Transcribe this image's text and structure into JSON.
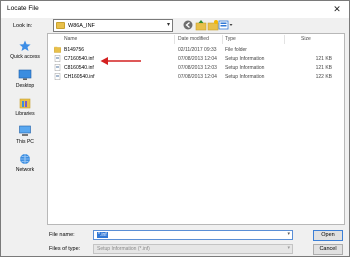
{
  "window": {
    "title": "Locate File",
    "close_glyph": "✕"
  },
  "toolbar": {
    "lookin_label": "Look in:",
    "lookin_value": "W86A_INF",
    "icons": [
      "back-icon",
      "up-folder-icon",
      "new-folder-icon",
      "view-menu-icon"
    ]
  },
  "sidebar": {
    "items": [
      {
        "label": "Quick access",
        "icon": "star-icon"
      },
      {
        "label": "Desktop",
        "icon": "desktop-icon"
      },
      {
        "label": "Libraries",
        "icon": "libraries-icon"
      },
      {
        "label": "This PC",
        "icon": "computer-icon"
      },
      {
        "label": "Network",
        "icon": "network-icon"
      }
    ]
  },
  "filelist": {
    "columns": [
      "Name",
      "Date modified",
      "Type",
      "Size"
    ],
    "rows": [
      {
        "name": "B149756",
        "date": "02/11/2017 09:33",
        "type": "File folder",
        "size": "",
        "icon": "folder-icon"
      },
      {
        "name": "C7160540.inf",
        "date": "07/08/2013 12:04",
        "type": "Setup Information",
        "size": "121 KB",
        "icon": "setup-file-icon"
      },
      {
        "name": "C8160540.inf",
        "date": "07/08/2013 12:03",
        "type": "Setup Information",
        "size": "121 KB",
        "icon": "setup-file-icon"
      },
      {
        "name": "CH160540.inf",
        "date": "07/08/2013 12:04",
        "type": "Setup Information",
        "size": "122 KB",
        "icon": "setup-file-icon"
      }
    ]
  },
  "bottom": {
    "filename_label": "File name:",
    "filename_value": "*.inf",
    "filetype_label": "Files of type:",
    "filetype_value": "Setup Information (*.inf)",
    "open_label": "Open",
    "cancel_label": "Cancel"
  },
  "colors": {
    "accent": "#3178d6",
    "annotation_arrow": "#d42020",
    "folder": "#e8c04a"
  }
}
